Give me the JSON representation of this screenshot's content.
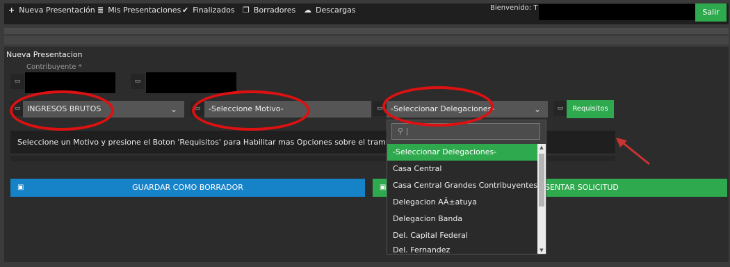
{
  "nav": {
    "items": [
      {
        "icon": "+",
        "label": "Nueva Presentación"
      },
      {
        "icon": "≣",
        "label": "Mis Presentaciones"
      },
      {
        "icon": "✔",
        "label": "Finalizados"
      },
      {
        "icon": "❐",
        "label": "Borradores"
      },
      {
        "icon": "☁",
        "label": "Descargas"
      }
    ],
    "welcome": "Bienvenido: T",
    "logout": "Salir"
  },
  "panel": {
    "title": "Nueva Presentacion",
    "contribuyente_label": "Contribuyente *"
  },
  "selects": {
    "impuesto": "INGRESOS BRUTOS",
    "motivo": "-Seleccione Motivo-",
    "delegaciones": "-Seleccionar Delegaciones-"
  },
  "requisitos_button": "Requisitos",
  "info_text": "Seleccione un Motivo y presione el Boton 'Requisitos' para Habilitar mas Opciones sobre el tramite que desea reali",
  "buttons": {
    "draft": "GUARDAR COMO BORRADOR",
    "submit": "SENTAR SOLICITUD"
  },
  "dropdown": {
    "search_value": "",
    "options": [
      "-Seleccionar Delegaciones-",
      "Casa Central",
      "Casa Central Grandes Contribuyentes",
      "Delegacion AÃ±atuya",
      "Delegacion Banda",
      "Del. Capital Federal",
      "Del. Fernandez"
    ],
    "selected_index": 0
  },
  "colors": {
    "accent_green": "#2fa94e",
    "accent_blue": "#1683c9",
    "annotation_red": "#dd1111"
  }
}
